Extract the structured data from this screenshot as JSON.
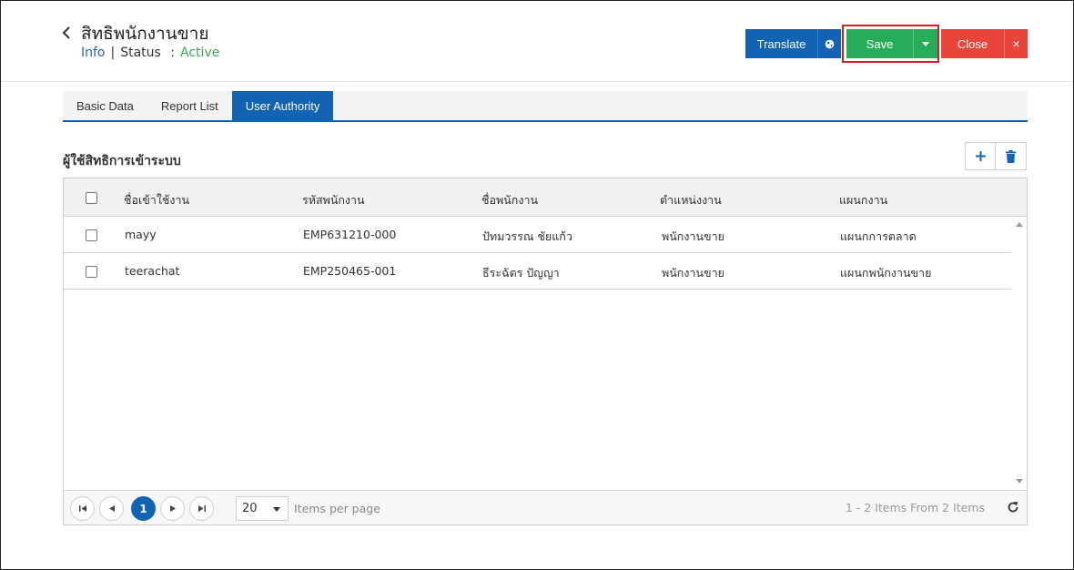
{
  "header": {
    "title": "สิทธิพนักงานขาย",
    "info_label": "Info",
    "status_label": "Status",
    "status_sep": ":",
    "status_value": "Active",
    "status_color": "#3aa757"
  },
  "toolbar": {
    "translate_label": "Translate",
    "save_label": "Save",
    "close_label": "Close",
    "close_x": "×",
    "accent": "#1363b4",
    "save_color": "#27ad5a",
    "close_color": "#e8443a"
  },
  "tabs": [
    {
      "label": "Basic Data",
      "active": false
    },
    {
      "label": "Report List",
      "active": false
    },
    {
      "label": "User Authority",
      "active": true
    }
  ],
  "section": {
    "title": "ผู้ใช้สิทธิการเข้าระบบ",
    "add_icon": "plus-icon",
    "delete_icon": "trash-icon"
  },
  "grid": {
    "columns": [
      "ชื่อเข้าใช้งาน",
      "รหัสพนักงาน",
      "ชื่อพนักงาน",
      "ตำแหน่งงาน",
      "แผนกงาน"
    ],
    "rows": [
      {
        "username": "mayy",
        "emp_code": "EMP631210-000",
        "emp_name": "ปัทมวรรณ ชัยแก้ว",
        "position": "พนักงานขาย",
        "department": "แผนกการตลาด"
      },
      {
        "username": "teerachat",
        "emp_code": "EMP250465-001",
        "emp_name": "ธีระฉัตร ปัญญา",
        "position": "พนักงานขาย",
        "department": "แผนกพนักงานขาย"
      }
    ]
  },
  "pager": {
    "current_page": "1",
    "page_size": "20",
    "items_per_page_label": "Items per page",
    "range_text": "1 - 2 Items From 2 Items"
  }
}
